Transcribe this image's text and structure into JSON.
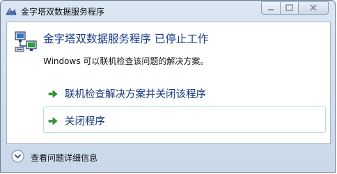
{
  "window": {
    "title": "金字塔双数据服务程序"
  },
  "dialog": {
    "headline": "金字塔双数据服务程序 已停止工作",
    "description": "Windows 可以联机检查该问题的解决方案。",
    "options": [
      {
        "label": "联机检查解决方案并关闭该程序",
        "icon": "green-arrow-icon"
      },
      {
        "label": "关闭程序",
        "icon": "green-arrow-icon"
      }
    ],
    "details_label": "查看问题详细信息"
  },
  "icons": {
    "app": "app-icon",
    "header": "network-computer-icon",
    "details": "chevron-down-icon"
  },
  "colors": {
    "headline": "#1a3c8c",
    "option_text": "#1b3a7a",
    "arrow": "#2e9b2e"
  }
}
